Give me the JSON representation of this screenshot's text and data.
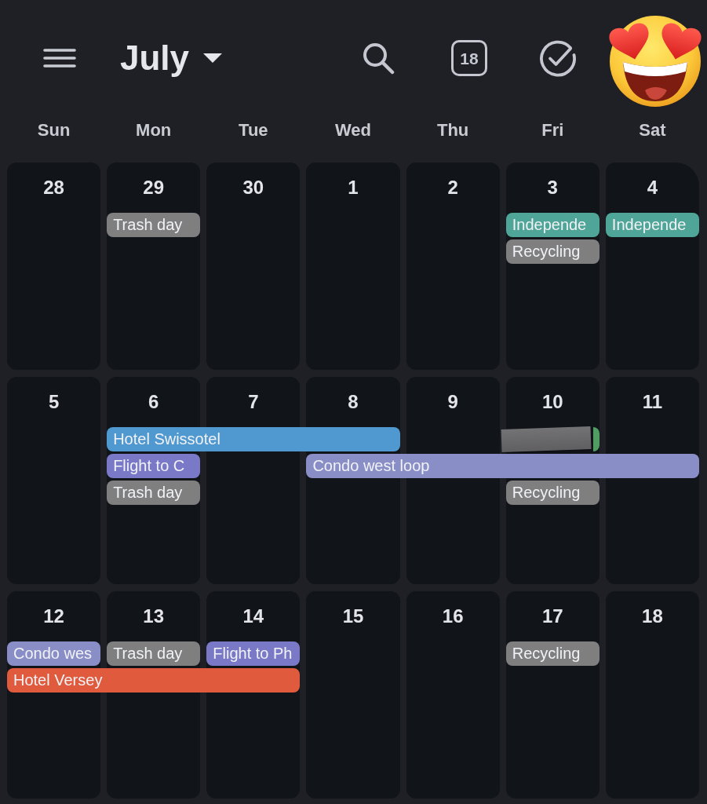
{
  "header": {
    "month": "July",
    "today": "18"
  },
  "weekdays": [
    "Sun",
    "Mon",
    "Tue",
    "Wed",
    "Thu",
    "Fri",
    "Sat"
  ],
  "weeks": [
    {
      "days": [
        {
          "date": "28"
        },
        {
          "date": "29",
          "events": [
            {
              "kind": "event",
              "title": "Trash day",
              "color": "#7f7f80",
              "covered": false
            }
          ]
        },
        {
          "date": "30"
        },
        {
          "date": "1"
        },
        {
          "date": "2"
        },
        {
          "date": "3",
          "events": [
            {
              "kind": "event",
              "title": "Independe",
              "color": "#4fa597",
              "covered": false
            },
            {
              "kind": "event",
              "title": "Recycling",
              "color": "#7f7f80",
              "covered": false
            }
          ]
        },
        {
          "date": "4",
          "events": [
            {
              "kind": "event",
              "title": "Independe",
              "color": "#4fa597",
              "covered": false
            }
          ]
        }
      ]
    },
    {
      "days": [
        {
          "date": "5"
        },
        {
          "date": "6",
          "events": [
            {
              "kind": "event",
              "title": "Hotel Swissotel",
              "color": "#4f98d0",
              "covered": false
            },
            {
              "kind": "event",
              "title": "Flight to C",
              "color": "#7a79c8",
              "covered": false
            },
            {
              "kind": "event",
              "title": "Trash day",
              "color": "#7f7f80",
              "covered": false
            }
          ]
        },
        {
          "date": "7",
          "events": [
            {
              "kind": "continued"
            }
          ]
        },
        {
          "date": "8",
          "events": [
            {
              "kind": "continued"
            },
            {
              "kind": "event",
              "title": "Condo west loop",
              "color": "#8a8ec6",
              "covered": false
            }
          ]
        },
        {
          "date": "9",
          "events": [
            {
              "kind": "gap"
            },
            {
              "kind": "continued"
            }
          ]
        },
        {
          "date": "10",
          "events": [
            {
              "kind": "event",
              "color": "#4f9d63",
              "covered": true
            },
            {
              "kind": "continued"
            },
            {
              "kind": "event",
              "title": "Recycling",
              "color": "#7f7f80",
              "covered": false
            }
          ]
        },
        {
          "date": "11",
          "events": [
            {
              "kind": "gap"
            },
            {
              "kind": "continued"
            }
          ]
        }
      ]
    },
    {
      "days": [
        {
          "date": "12",
          "events": [
            {
              "kind": "event",
              "title": "Condo wes",
              "color": "#8a8ec6",
              "covered": false
            },
            {
              "kind": "event",
              "title": "Hotel Versey",
              "color": "#e05a3e",
              "covered": false
            }
          ]
        },
        {
          "date": "13",
          "events": [
            {
              "kind": "event",
              "title": "Trash day",
              "color": "#7f7f80",
              "covered": false
            },
            {
              "kind": "continued"
            }
          ]
        },
        {
          "date": "14",
          "events": [
            {
              "kind": "event",
              "title": "Flight to Ph",
              "color": "#7a79c8",
              "covered": false
            },
            {
              "kind": "continued"
            }
          ]
        },
        {
          "date": "15"
        },
        {
          "date": "16"
        },
        {
          "date": "17",
          "events": [
            {
              "kind": "event",
              "title": "Recycling",
              "color": "#7f7f80",
              "covered": false
            }
          ]
        },
        {
          "date": "18"
        }
      ]
    }
  ]
}
